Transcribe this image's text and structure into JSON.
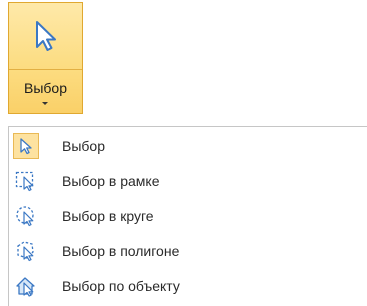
{
  "split_button": {
    "label": "Выбор",
    "icon": "cursor-arrow-icon",
    "state": "highlighted"
  },
  "menu": {
    "items": [
      {
        "label": "Выбор",
        "icon": "arrow-select-icon",
        "selected": true
      },
      {
        "label": "Выбор в рамке",
        "icon": "rectangle-select-icon",
        "selected": false
      },
      {
        "label": "Выбор в круге",
        "icon": "circle-select-icon",
        "selected": false
      },
      {
        "label": "Выбор в полигоне",
        "icon": "polygon-select-icon",
        "selected": false
      },
      {
        "label": "Выбор по объекту",
        "icon": "object-select-icon",
        "selected": false
      }
    ]
  },
  "colors": {
    "highlight_fill": "#fcdc80",
    "highlight_border": "#e0a830",
    "icon_blue": "#3b78c4",
    "menu_border": "#c6c6c6"
  }
}
